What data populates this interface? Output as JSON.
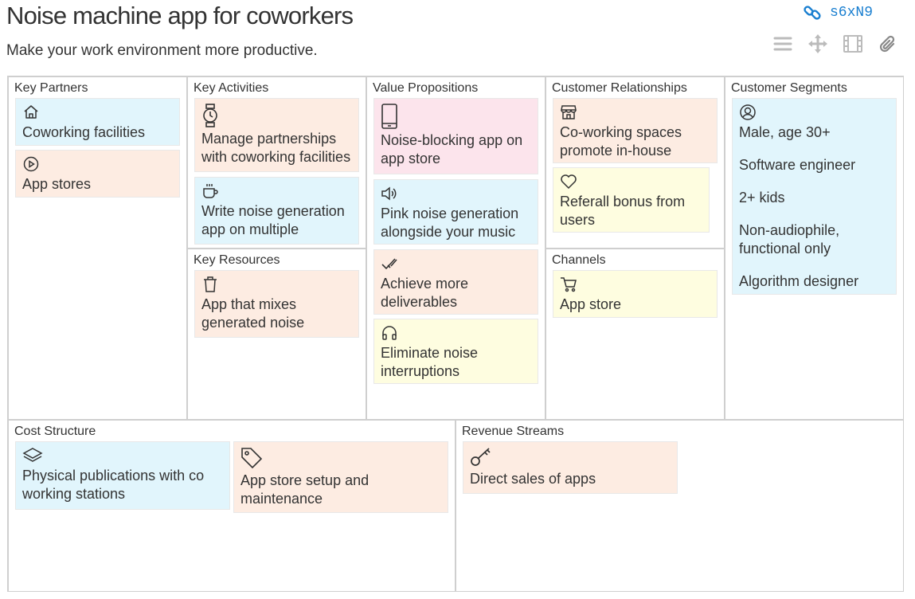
{
  "title": "Noise machine app for coworkers",
  "subtitle": "Make your work environment more productive.",
  "share": {
    "icon": "link-icon",
    "code": "s6xN9"
  },
  "toolbar": [
    "list-icon",
    "move-icon",
    "film-icon",
    "paperclip-icon"
  ],
  "colors": {
    "blue": "#e1f5fc",
    "peach": "#fdece2",
    "pink": "#fce4ec",
    "yellow": "#fefde0",
    "accent": "#1a7fd0"
  },
  "blocks": {
    "key_partners": {
      "title": "Key Partners",
      "notes": [
        {
          "icon": "home-icon",
          "text": "Coworking facilities",
          "color": "blue"
        },
        {
          "icon": "play-circle-icon",
          "text": "App stores",
          "color": "peach"
        }
      ]
    },
    "key_activities": {
      "title": "Key Activities",
      "notes": [
        {
          "icon": "watch-icon",
          "text": "Manage partnerships with coworking facilities",
          "color": "peach"
        },
        {
          "icon": "coffee-icon",
          "text": "Write noise generation app on multiple",
          "color": "blue"
        }
      ]
    },
    "key_resources": {
      "title": "Key Resources",
      "notes": [
        {
          "icon": "trash-icon",
          "text": "App that mixes generated noise",
          "color": "peach"
        }
      ]
    },
    "value_propositions": {
      "title": "Value Propositions",
      "notes": [
        {
          "icon": "phone-icon",
          "text": "Noise-blocking app on app store",
          "color": "pink"
        },
        {
          "icon": "speaker-icon",
          "text": "Pink noise generation alongside your music",
          "color": "blue"
        },
        {
          "icon": "check-icon",
          "text": "Achieve more deliverables",
          "color": "peach"
        },
        {
          "icon": "headphones-icon",
          "text": "Eliminate noise interruptions",
          "color": "yellow"
        }
      ]
    },
    "customer_relationships": {
      "title": "Customer Relationships",
      "notes": [
        {
          "icon": "store-icon",
          "text": "Co-working spaces promote in-house",
          "color": "peach"
        },
        {
          "icon": "heart-icon",
          "text": "Referall bonus from users",
          "color": "yellow"
        }
      ]
    },
    "channels": {
      "title": "Channels",
      "notes": [
        {
          "icon": "cart-icon",
          "text": "App store",
          "color": "yellow"
        }
      ]
    },
    "customer_segments": {
      "title": "Customer Segments",
      "note": {
        "icon": "user-circle-icon",
        "color": "blue",
        "lines": [
          "Male, age 30+",
          "Software engineer",
          "2+ kids",
          "Non-audiophile, functional only",
          "Algorithm designer"
        ]
      }
    },
    "cost_structure": {
      "title": "Cost Structure",
      "notes": [
        {
          "icon": "layers-icon",
          "text": "Physical publications with co working stations",
          "color": "blue"
        },
        {
          "icon": "tag-icon",
          "text": "App store setup and maintenance",
          "color": "peach"
        }
      ]
    },
    "revenue_streams": {
      "title": "Revenue Streams",
      "notes": [
        {
          "icon": "key-icon",
          "text": "Direct sales of apps",
          "color": "peach"
        }
      ]
    }
  }
}
